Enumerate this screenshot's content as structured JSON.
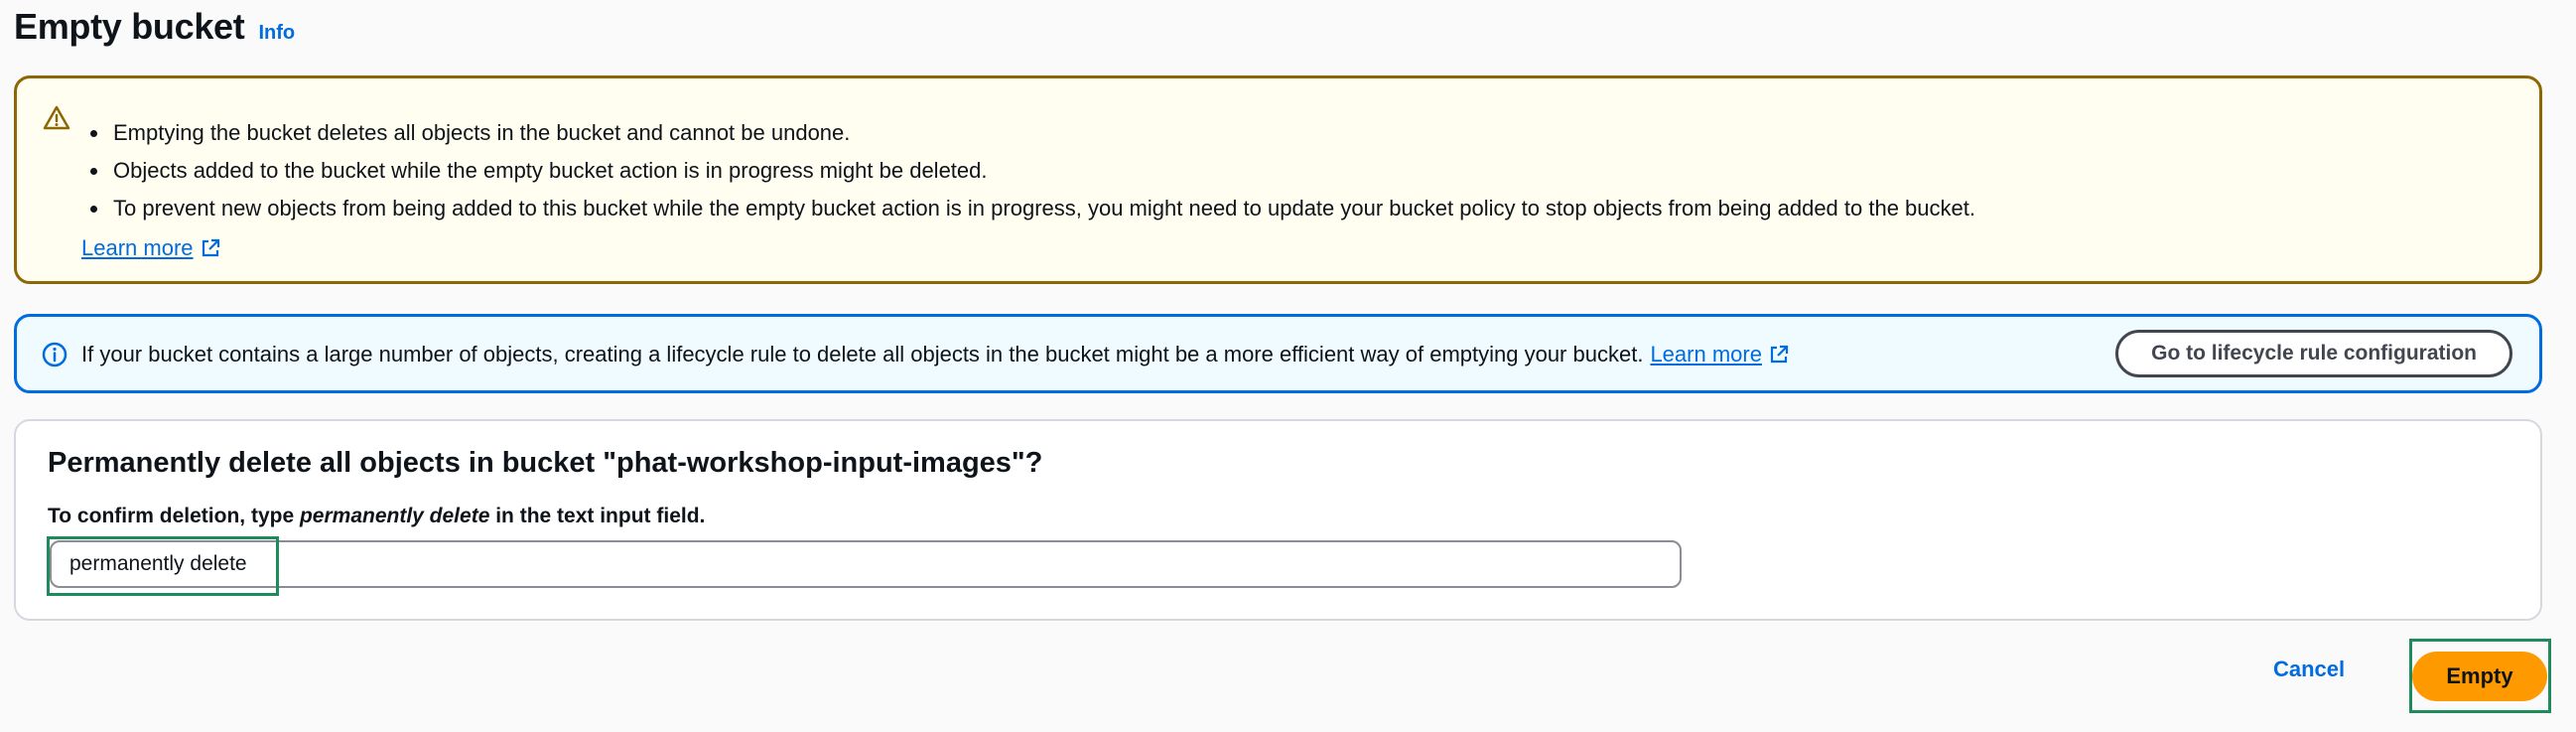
{
  "header": {
    "title": "Empty bucket",
    "info_link": "Info"
  },
  "warning_alert": {
    "icon": "warning-icon",
    "items": [
      "Emptying the bucket deletes all objects in the bucket and cannot be undone.",
      "Objects added to the bucket while the empty bucket action is in progress might be deleted.",
      "To prevent new objects from being added to this bucket while the empty bucket action is in progress, you might need to update your bucket policy to stop objects from being added to the bucket."
    ],
    "learn_more": "Learn more"
  },
  "info_alert": {
    "icon": "info-icon",
    "text": "If your bucket contains a large number of objects, creating a lifecycle rule to delete all objects in the bucket might be a more efficient way of emptying your bucket.",
    "learn_more": "Learn more",
    "button_label": "Go to lifecycle rule configuration"
  },
  "confirm": {
    "heading": "Permanently delete all objects in bucket \"phat-workshop-input-images\"?",
    "instruction_prefix": "To confirm deletion, type ",
    "instruction_emphasis": "permanently delete",
    "instruction_suffix": " in the text input field.",
    "input_value": "permanently delete"
  },
  "actions": {
    "cancel_label": "Cancel",
    "empty_label": "Empty"
  },
  "colors": {
    "warning_border": "#8d6605",
    "warning_background": "#fffef0",
    "info_border": "#006ce0",
    "info_background": "#f0fbff",
    "primary_button": "#ff9900",
    "link": "#006ce0",
    "highlight_box": "#1f8a5b"
  }
}
